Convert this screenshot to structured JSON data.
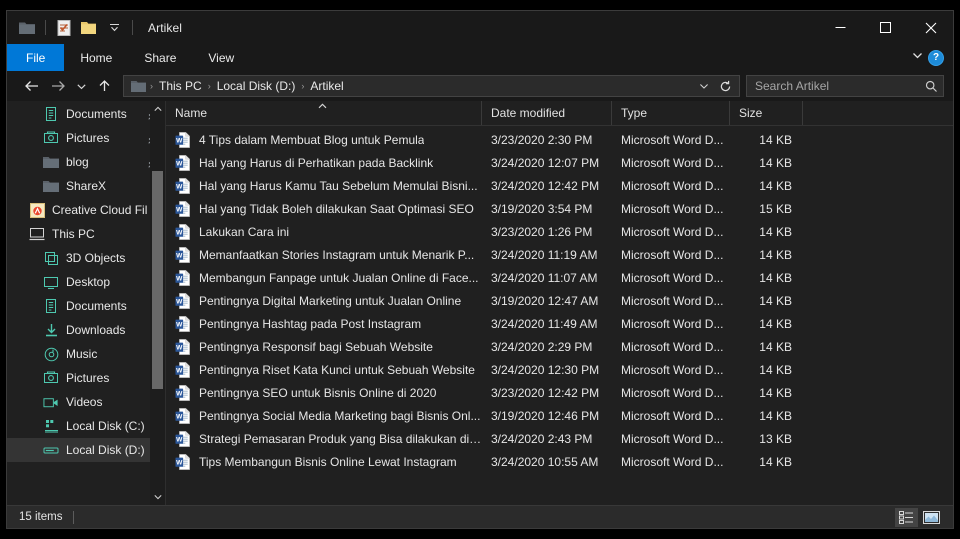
{
  "window": {
    "title": "Artikel",
    "accent_color": "#0078d7",
    "background": "#202020",
    "titlebar_background": "#191919"
  },
  "quick_access_toolbar": {
    "items": [
      {
        "name": "folder-icon",
        "label": "Artikel"
      },
      {
        "name": "properties-icon",
        "label": "Properties"
      },
      {
        "name": "new-folder-icon",
        "label": "New folder"
      },
      {
        "name": "customize-dropdown-icon",
        "label": "Customize Quick Access Toolbar"
      }
    ]
  },
  "window_controls": {
    "minimize": "─",
    "maximize": "☐",
    "close": "✕"
  },
  "ribbon": {
    "tabs": [
      {
        "label": "File",
        "active": true
      },
      {
        "label": "Home",
        "active": false
      },
      {
        "label": "Share",
        "active": false
      },
      {
        "label": "View",
        "active": false
      }
    ],
    "expand_label": "⌄",
    "help_label": "?"
  },
  "addressbar": {
    "back": "←",
    "forward": "→",
    "recent": "⌄",
    "up": "↑",
    "refresh": "↻",
    "history_dropdown": "⌄",
    "breadcrumbs": [
      {
        "label": "This PC"
      },
      {
        "label": "Local Disk (D:)"
      },
      {
        "label": "Artikel"
      }
    ],
    "separator": "›"
  },
  "search": {
    "placeholder": "Search Artikel",
    "value": "",
    "icon": "search-icon"
  },
  "sidebar": {
    "items": [
      {
        "label": "Documents",
        "icon": "documents-icon",
        "indent": 2,
        "pinned": true,
        "selected": false
      },
      {
        "label": "Pictures",
        "icon": "pictures-icon",
        "indent": 2,
        "pinned": true,
        "selected": false
      },
      {
        "label": "blog",
        "icon": "folder-icon",
        "indent": 2,
        "pinned": true,
        "selected": false
      },
      {
        "label": "ShareX",
        "icon": "folder-icon",
        "indent": 2,
        "pinned": false,
        "selected": false
      },
      {
        "label": "Creative Cloud Fil",
        "icon": "creative-cloud-icon",
        "indent": 1,
        "pinned": false,
        "selected": false
      },
      {
        "label": "This PC",
        "icon": "this-pc-icon",
        "indent": 1,
        "pinned": false,
        "selected": false
      },
      {
        "label": "3D Objects",
        "icon": "3d-objects-icon",
        "indent": 2,
        "pinned": false,
        "selected": false
      },
      {
        "label": "Desktop",
        "icon": "desktop-icon",
        "indent": 2,
        "pinned": false,
        "selected": false
      },
      {
        "label": "Documents",
        "icon": "documents-icon",
        "indent": 2,
        "pinned": false,
        "selected": false
      },
      {
        "label": "Downloads",
        "icon": "downloads-icon",
        "indent": 2,
        "pinned": false,
        "selected": false
      },
      {
        "label": "Music",
        "icon": "music-icon",
        "indent": 2,
        "pinned": false,
        "selected": false
      },
      {
        "label": "Pictures",
        "icon": "pictures-icon",
        "indent": 2,
        "pinned": false,
        "selected": false
      },
      {
        "label": "Videos",
        "icon": "videos-icon",
        "indent": 2,
        "pinned": false,
        "selected": false
      },
      {
        "label": "Local Disk (C:)",
        "icon": "local-disk-c-icon",
        "indent": 2,
        "pinned": false,
        "selected": false
      },
      {
        "label": "Local Disk (D:)",
        "icon": "local-disk-d-icon",
        "indent": 2,
        "pinned": false,
        "selected": true
      }
    ],
    "scroll_up": "⌃",
    "scroll_down": "⌄"
  },
  "filelist": {
    "columns": [
      {
        "label": "Name",
        "sorted": "ascending",
        "sort_caret": "⌃"
      },
      {
        "label": "Date modified",
        "sorted": null,
        "sort_caret": ""
      },
      {
        "label": "Type",
        "sorted": null,
        "sort_caret": ""
      },
      {
        "label": "Size",
        "sorted": null,
        "sort_caret": ""
      }
    ],
    "rows": [
      {
        "name": "4 Tips dalam Membuat Blog untuk Pemula",
        "date": "3/23/2020 2:30 PM",
        "type": "Microsoft Word D...",
        "size": "14 KB",
        "icon": "word-document-icon"
      },
      {
        "name": "Hal yang Harus di Perhatikan pada Backlink",
        "date": "3/24/2020 12:07 PM",
        "type": "Microsoft Word D...",
        "size": "14 KB",
        "icon": "word-document-icon"
      },
      {
        "name": "Hal yang Harus Kamu Tau Sebelum Memulai Bisni...",
        "date": "3/24/2020 12:42 PM",
        "type": "Microsoft Word D...",
        "size": "14 KB",
        "icon": "word-document-icon"
      },
      {
        "name": "Hal yang Tidak Boleh dilakukan Saat Optimasi SEO",
        "date": "3/19/2020 3:54 PM",
        "type": "Microsoft Word D...",
        "size": "15 KB",
        "icon": "word-document-icon"
      },
      {
        "name": "Lakukan Cara ini",
        "date": "3/23/2020 1:26 PM",
        "type": "Microsoft Word D...",
        "size": "14 KB",
        "icon": "word-document-icon"
      },
      {
        "name": "Memanfaatkan Stories Instagram untuk Menarik P...",
        "date": "3/24/2020 11:19 AM",
        "type": "Microsoft Word D...",
        "size": "14 KB",
        "icon": "word-document-icon"
      },
      {
        "name": "Membangun Fanpage untuk Jualan Online di Face...",
        "date": "3/24/2020 11:07 AM",
        "type": "Microsoft Word D...",
        "size": "14 KB",
        "icon": "word-document-icon"
      },
      {
        "name": "Pentingnya Digital Marketing untuk Jualan Online",
        "date": "3/19/2020 12:47 AM",
        "type": "Microsoft Word D...",
        "size": "14 KB",
        "icon": "word-document-icon"
      },
      {
        "name": "Pentingnya Hashtag pada Post Instagram",
        "date": "3/24/2020 11:49 AM",
        "type": "Microsoft Word D...",
        "size": "14 KB",
        "icon": "word-document-icon"
      },
      {
        "name": "Pentingnya Responsif bagi Sebuah Website",
        "date": "3/24/2020 2:29 PM",
        "type": "Microsoft Word D...",
        "size": "14 KB",
        "icon": "word-document-icon"
      },
      {
        "name": "Pentingnya Riset Kata Kunci untuk Sebuah Website",
        "date": "3/24/2020 12:30 PM",
        "type": "Microsoft Word D...",
        "size": "14 KB",
        "icon": "word-document-icon"
      },
      {
        "name": "Pentingnya SEO untuk Bisnis Online di 2020",
        "date": "3/23/2020 12:42 PM",
        "type": "Microsoft Word D...",
        "size": "14 KB",
        "icon": "word-document-icon"
      },
      {
        "name": "Pentingnya Social Media Marketing bagi Bisnis Onl...",
        "date": "3/19/2020 12:46 PM",
        "type": "Microsoft Word D...",
        "size": "14 KB",
        "icon": "word-document-icon"
      },
      {
        "name": "Strategi Pemasaran Produk yang Bisa dilakukan di ...",
        "date": "3/24/2020 2:43 PM",
        "type": "Microsoft Word D...",
        "size": "13 KB",
        "icon": "word-document-icon"
      },
      {
        "name": "Tips Membangun Bisnis Online Lewat Instagram",
        "date": "3/24/2020 10:55 AM",
        "type": "Microsoft Word D...",
        "size": "14 KB",
        "icon": "word-document-icon"
      }
    ]
  },
  "statusbar": {
    "item_count": "15 items",
    "views": [
      {
        "name": "details-view-button",
        "label": "Details view",
        "active": true
      },
      {
        "name": "large-icons-view-button",
        "label": "Large icons view",
        "active": false
      }
    ]
  }
}
